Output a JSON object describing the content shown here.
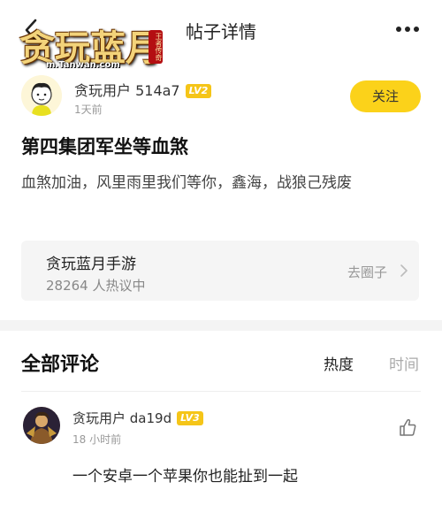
{
  "topbar": {
    "logo_text": "贪玩蓝月",
    "logo_sub": "m.Tanwan.com",
    "logo_seal": "王者传奇",
    "title": "帖子详情"
  },
  "author": {
    "name": "贪玩用户 514a7",
    "level": "LV2",
    "time": "1天前",
    "follow_label": "关注"
  },
  "post": {
    "title": "第四集团军坐等血煞",
    "body": "血煞加油，风里雨里我们等你，鑫海，战狼己残废"
  },
  "circle": {
    "name": "贪玩蓝月手游",
    "stats": "28264 人热议中",
    "goto_label": "去圈子"
  },
  "comments": {
    "title": "全部评论",
    "sort_hot": "热度",
    "sort_time": "时间",
    "items": [
      {
        "author": "贪玩用户 da19d",
        "level": "LV3",
        "time": "18 小时前",
        "text": "一个安卓一个苹果你也能扯到一起"
      }
    ]
  },
  "colors": {
    "accent_yellow": "#fbd21a",
    "badge_yellow": "#f5c518",
    "muted_text": "#999999"
  },
  "icons": [
    "back-icon",
    "more-icon",
    "chevron-right-icon",
    "thumb-up-icon"
  ]
}
